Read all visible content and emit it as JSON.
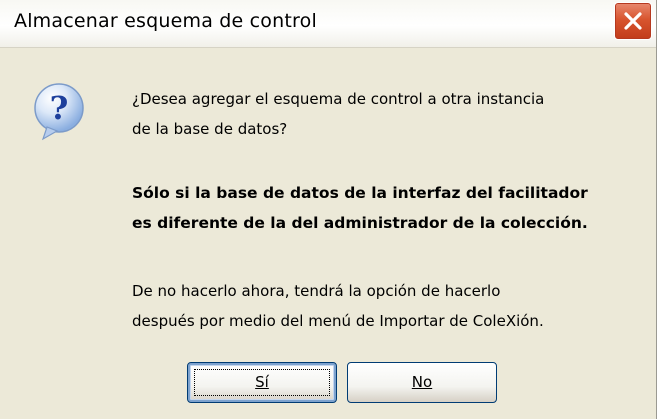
{
  "dialog": {
    "title": "Almacenar esquema de control",
    "close_icon": "close-icon",
    "question_icon": "question-icon",
    "message_line1": "¿Desea agregar el esquema de control a otra instancia",
    "message_line2": "de la base de datos?",
    "bold_line1": "Sólo si la base de datos de la interfaz del facilitador",
    "bold_line2": "es diferente de la del administrador de la colección.",
    "note_line1": "De no hacerlo ahora, tendrá la opción de hacerlo",
    "note_line2": "después por medio del menú de Importar de ColeXión.",
    "buttons": {
      "yes_label": "Sí",
      "no_label": "No"
    }
  },
  "colors": {
    "dialog_bg": "#ece9d8",
    "close_red": "#d8552f",
    "button_border": "#003c74"
  }
}
